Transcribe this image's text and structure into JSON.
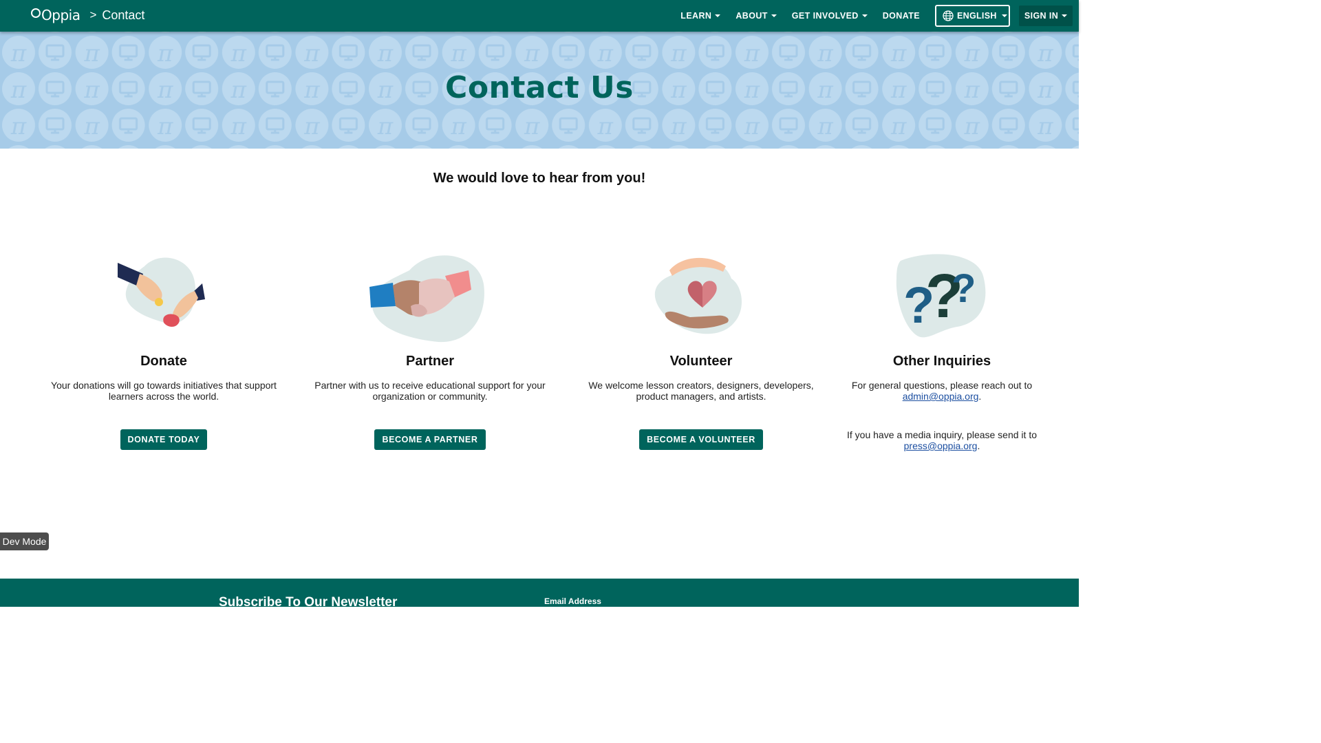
{
  "navbar": {
    "brand": "Oppia",
    "breadcrumb_sep": ">",
    "breadcrumb": "Contact",
    "items": [
      {
        "label": "LEARN"
      },
      {
        "label": "ABOUT"
      },
      {
        "label": "GET INVOLVED"
      },
      {
        "label": "DONATE"
      }
    ],
    "language": "ENGLISH",
    "sign_in": "SIGN IN"
  },
  "banner": {
    "title": "Contact Us"
  },
  "subheading": "We would love to hear from you!",
  "cards": [
    {
      "title": "Donate",
      "text": "Your donations will go towards initiatives that support learners across the world.",
      "button": "DONATE TODAY"
    },
    {
      "title": "Partner",
      "text": "Partner with us to receive educational support for your organization or community.",
      "button": "BECOME A PARTNER"
    },
    {
      "title": "Volunteer",
      "text": "We welcome lesson creators, designers, developers, product managers, and artists.",
      "button": "BECOME A VOLUNTEER"
    },
    {
      "title": "Other Inquiries",
      "text_general": "For general questions, please reach out to",
      "email_general": "admin@oppia.org",
      "text_media": "If you have a media inquiry, please send it to",
      "email_media": "press@oppia.org",
      "period": "."
    }
  ],
  "dev_mode": "Dev Mode",
  "footer": {
    "newsletter_title": "Subscribe To Our Newsletter",
    "email_label": "Email Address"
  },
  "colors": {
    "primary": "#00645c",
    "banner_bg": "#a6cbe8",
    "link": "#1b4ea0"
  }
}
